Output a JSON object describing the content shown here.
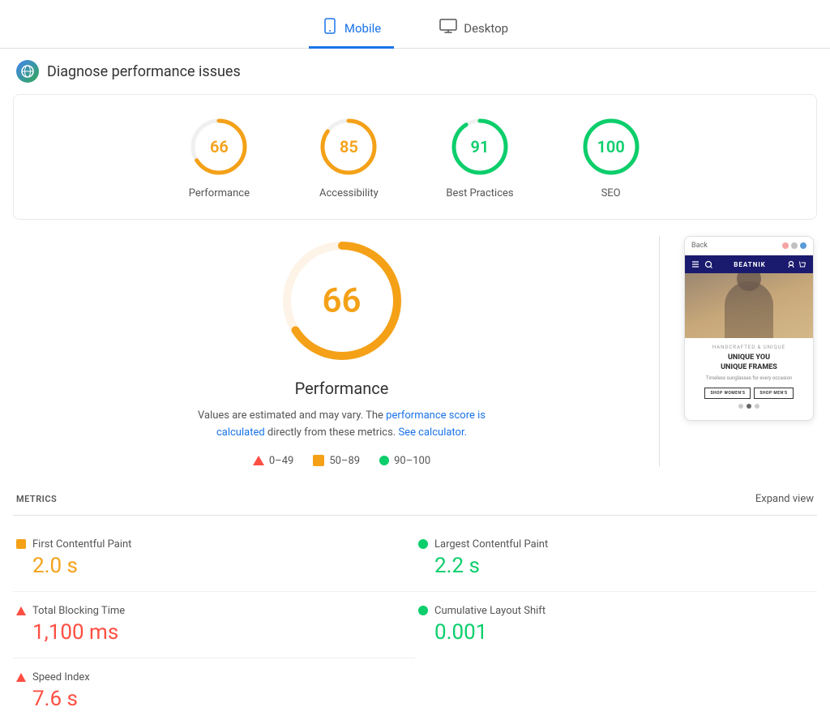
{
  "tabs": [
    {
      "id": "mobile",
      "label": "Mobile",
      "active": true,
      "icon": "mobile"
    },
    {
      "id": "desktop",
      "label": "Desktop",
      "active": false,
      "icon": "desktop"
    }
  ],
  "header": {
    "title": "Diagnose performance issues",
    "icon_label": "globe"
  },
  "scores": [
    {
      "id": "performance",
      "value": 66,
      "label": "Performance",
      "color": "#f4a118",
      "dash": 157,
      "offset": 53
    },
    {
      "id": "accessibility",
      "value": 85,
      "label": "Accessibility",
      "color": "#f4a118",
      "dash": 157,
      "offset": 24
    },
    {
      "id": "best-practices",
      "value": 91,
      "label": "Best Practices",
      "color": "#0cce6b",
      "dash": 157,
      "offset": 14
    },
    {
      "id": "seo",
      "value": 100,
      "label": "SEO",
      "color": "#0cce6b",
      "dash": 157,
      "offset": 0
    }
  ],
  "main_score": {
    "value": "66",
    "label": "Performance",
    "description_text": "Values are estimated and may vary. The",
    "link1_text": "performance score is calculated",
    "description_mid": "directly from these metrics.",
    "link2_text": "See calculator.",
    "color": "#f4a118"
  },
  "legend": [
    {
      "id": "red",
      "range": "0–49",
      "type": "triangle"
    },
    {
      "id": "orange",
      "range": "50–89",
      "type": "square"
    },
    {
      "id": "green",
      "range": "90–100",
      "type": "circle"
    }
  ],
  "phone": {
    "back_label": "Back",
    "dots": [
      "#f5a4a4",
      "#c0c0c0",
      "#5b9bd5"
    ],
    "nav_text": "BEATNIK",
    "subtitle": "HANDCRAFTED & UNIQUE",
    "heading": "UNIQUE YOU\nUNIQUE FRAMES",
    "subheading": "Timeless sunglasses for every occasion",
    "btn1": "SHOP WOMEN'S",
    "btn2": "SHOP MEN'S"
  },
  "metrics_section": {
    "title": "METRICS",
    "expand_label": "Expand view"
  },
  "metrics": [
    {
      "id": "fcp",
      "name": "First Contentful Paint",
      "value": "2.0 s",
      "color": "orange",
      "indicator": "orange"
    },
    {
      "id": "lcp",
      "name": "Largest Contentful Paint",
      "value": "2.2 s",
      "color": "green",
      "indicator": "green"
    },
    {
      "id": "tbt",
      "name": "Total Blocking Time",
      "value": "1,100 ms",
      "color": "red",
      "indicator": "red"
    },
    {
      "id": "cls",
      "name": "Cumulative Layout Shift",
      "value": "0.001",
      "color": "green",
      "indicator": "green"
    },
    {
      "id": "si",
      "name": "Speed Index",
      "value": "7.6 s",
      "color": "red",
      "indicator": "red"
    }
  ]
}
